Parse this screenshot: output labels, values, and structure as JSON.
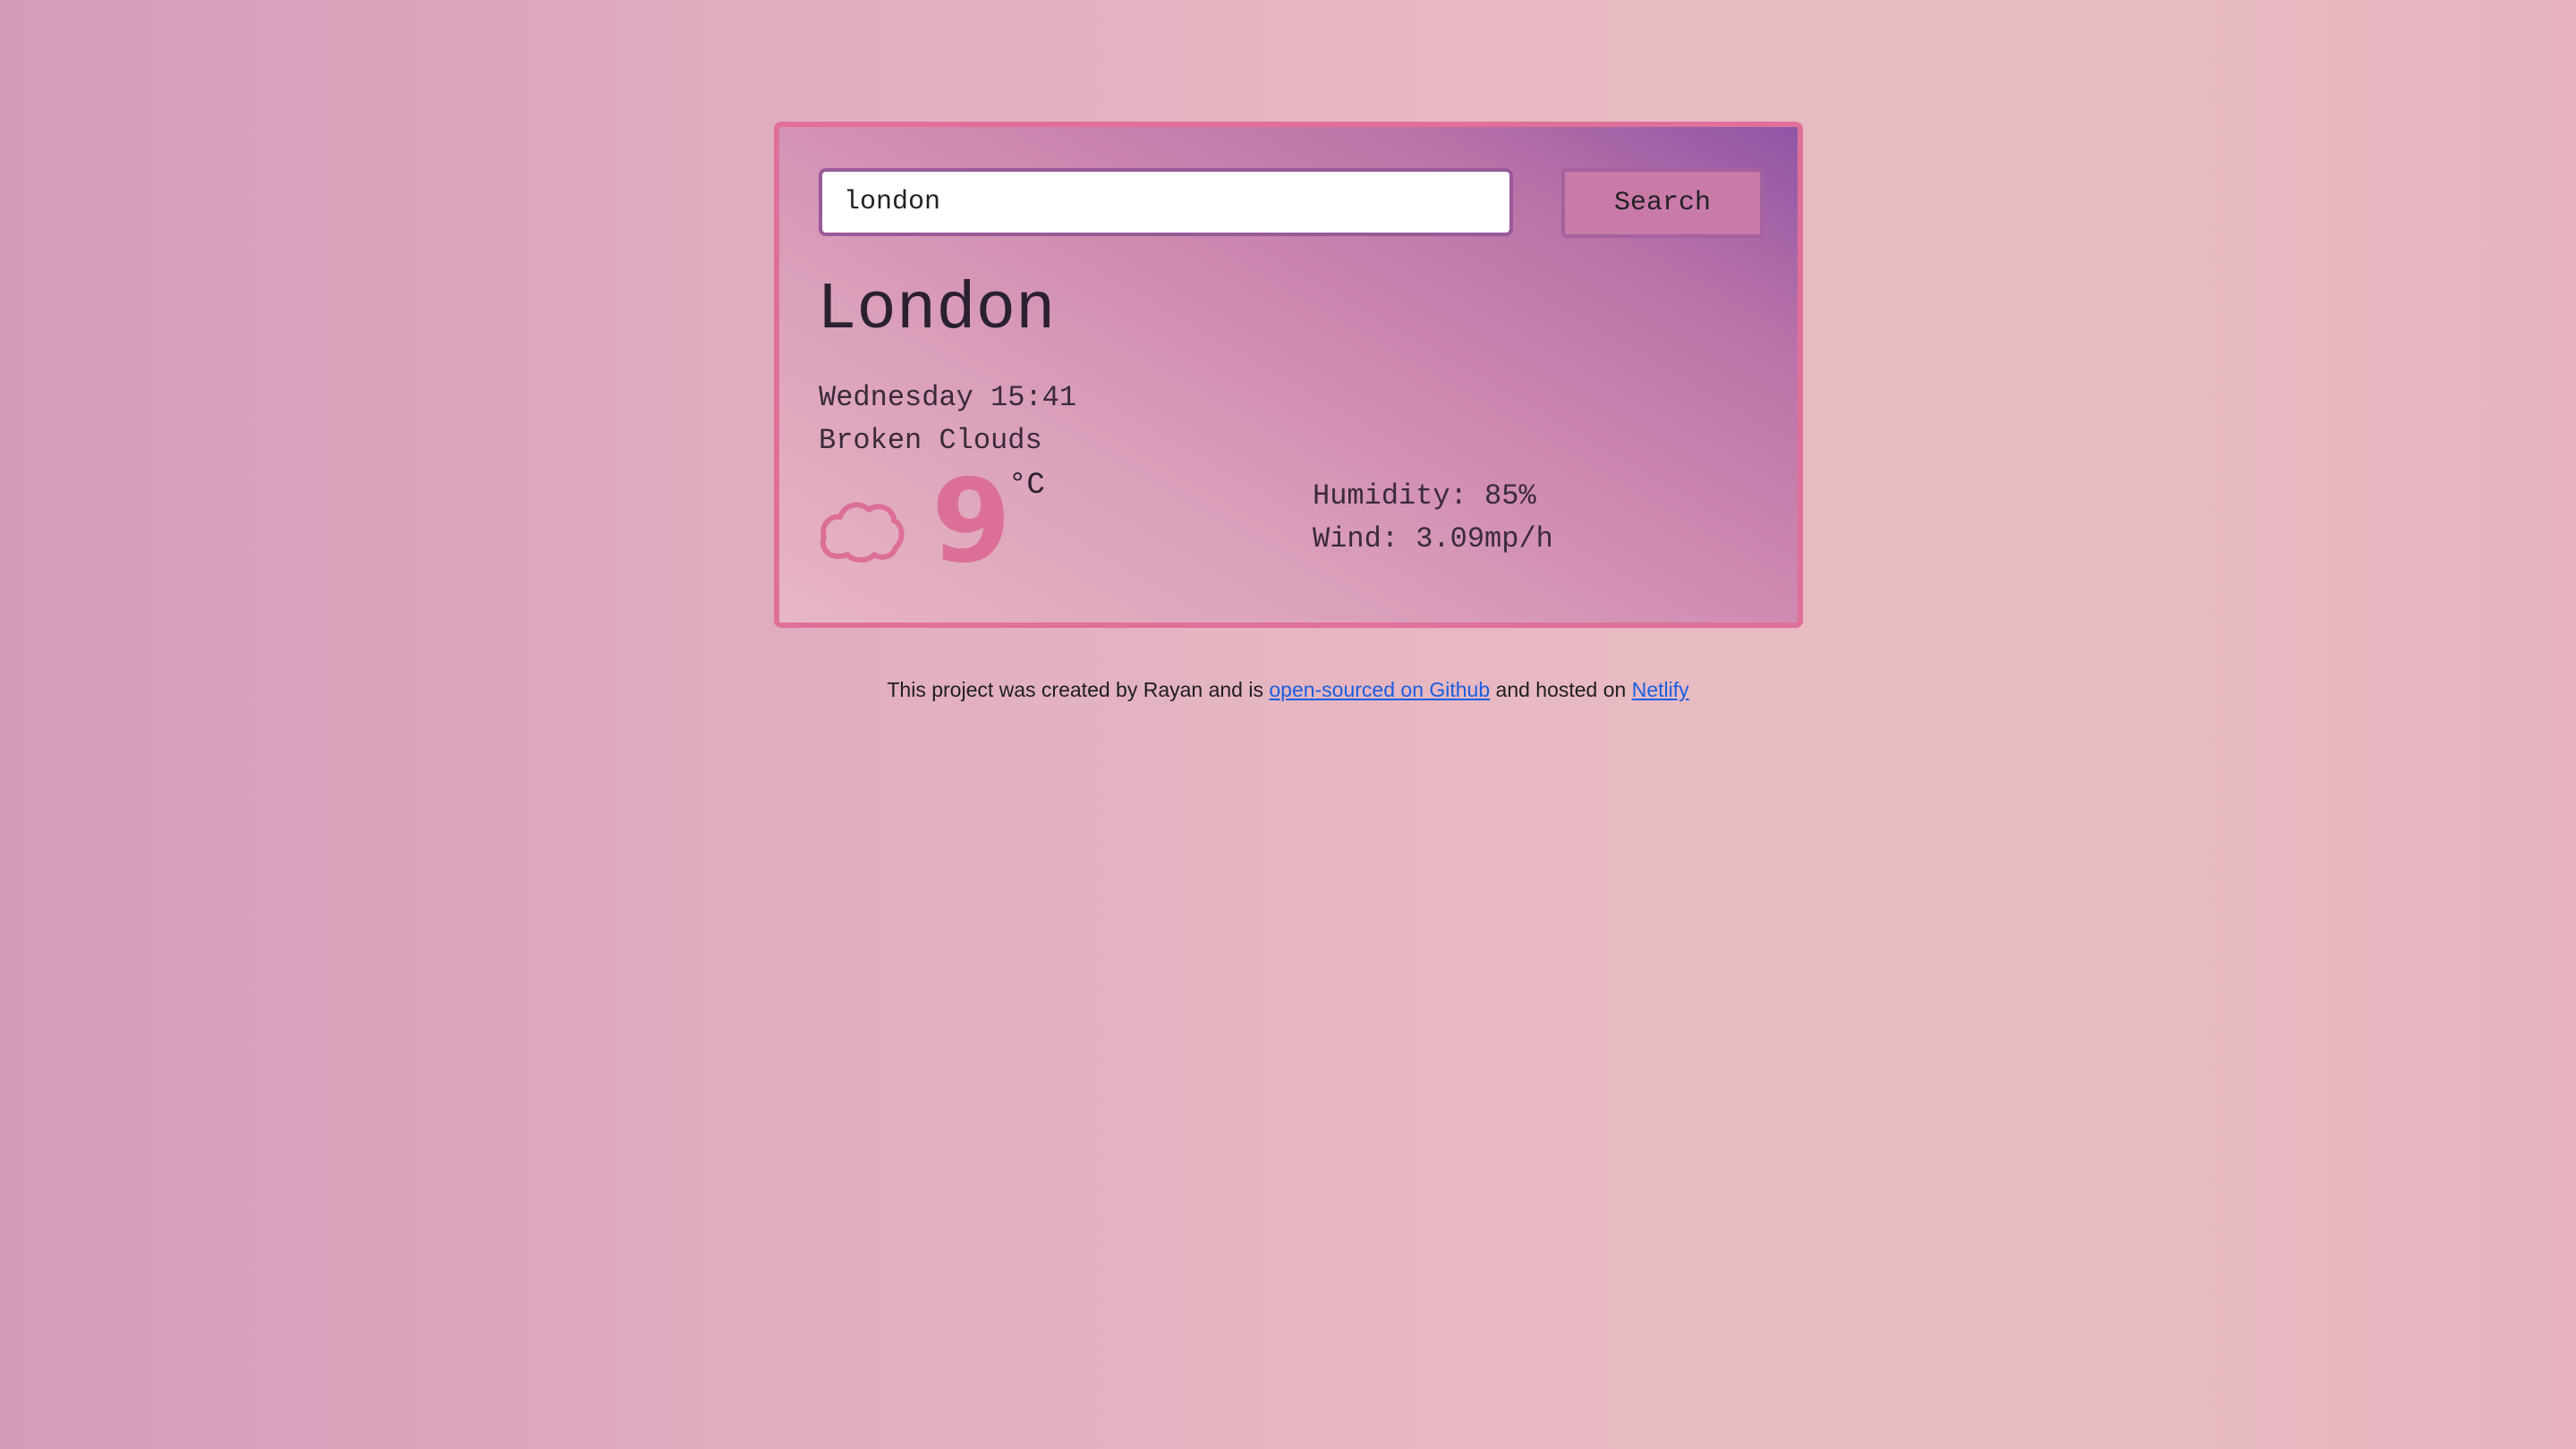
{
  "search": {
    "value": "london",
    "button_label": "Search"
  },
  "weather": {
    "city": "London",
    "datetime": "Wednesday 15:41",
    "description": "Broken Clouds",
    "icon": "cloud-icon",
    "temperature": "9",
    "unit": "°C",
    "humidity": "Humidity: 85%",
    "wind": "Wind: 3.09mp/h"
  },
  "footer": {
    "text_before": "This project was created by Rayan and is ",
    "github_link": "open-sourced on Github",
    "text_middle": " and hosted on ",
    "netlify_link": "Netlify"
  },
  "colors": {
    "accent": "#dc6f98",
    "card_border": "#e0709a",
    "link": "#1a5ee0"
  }
}
